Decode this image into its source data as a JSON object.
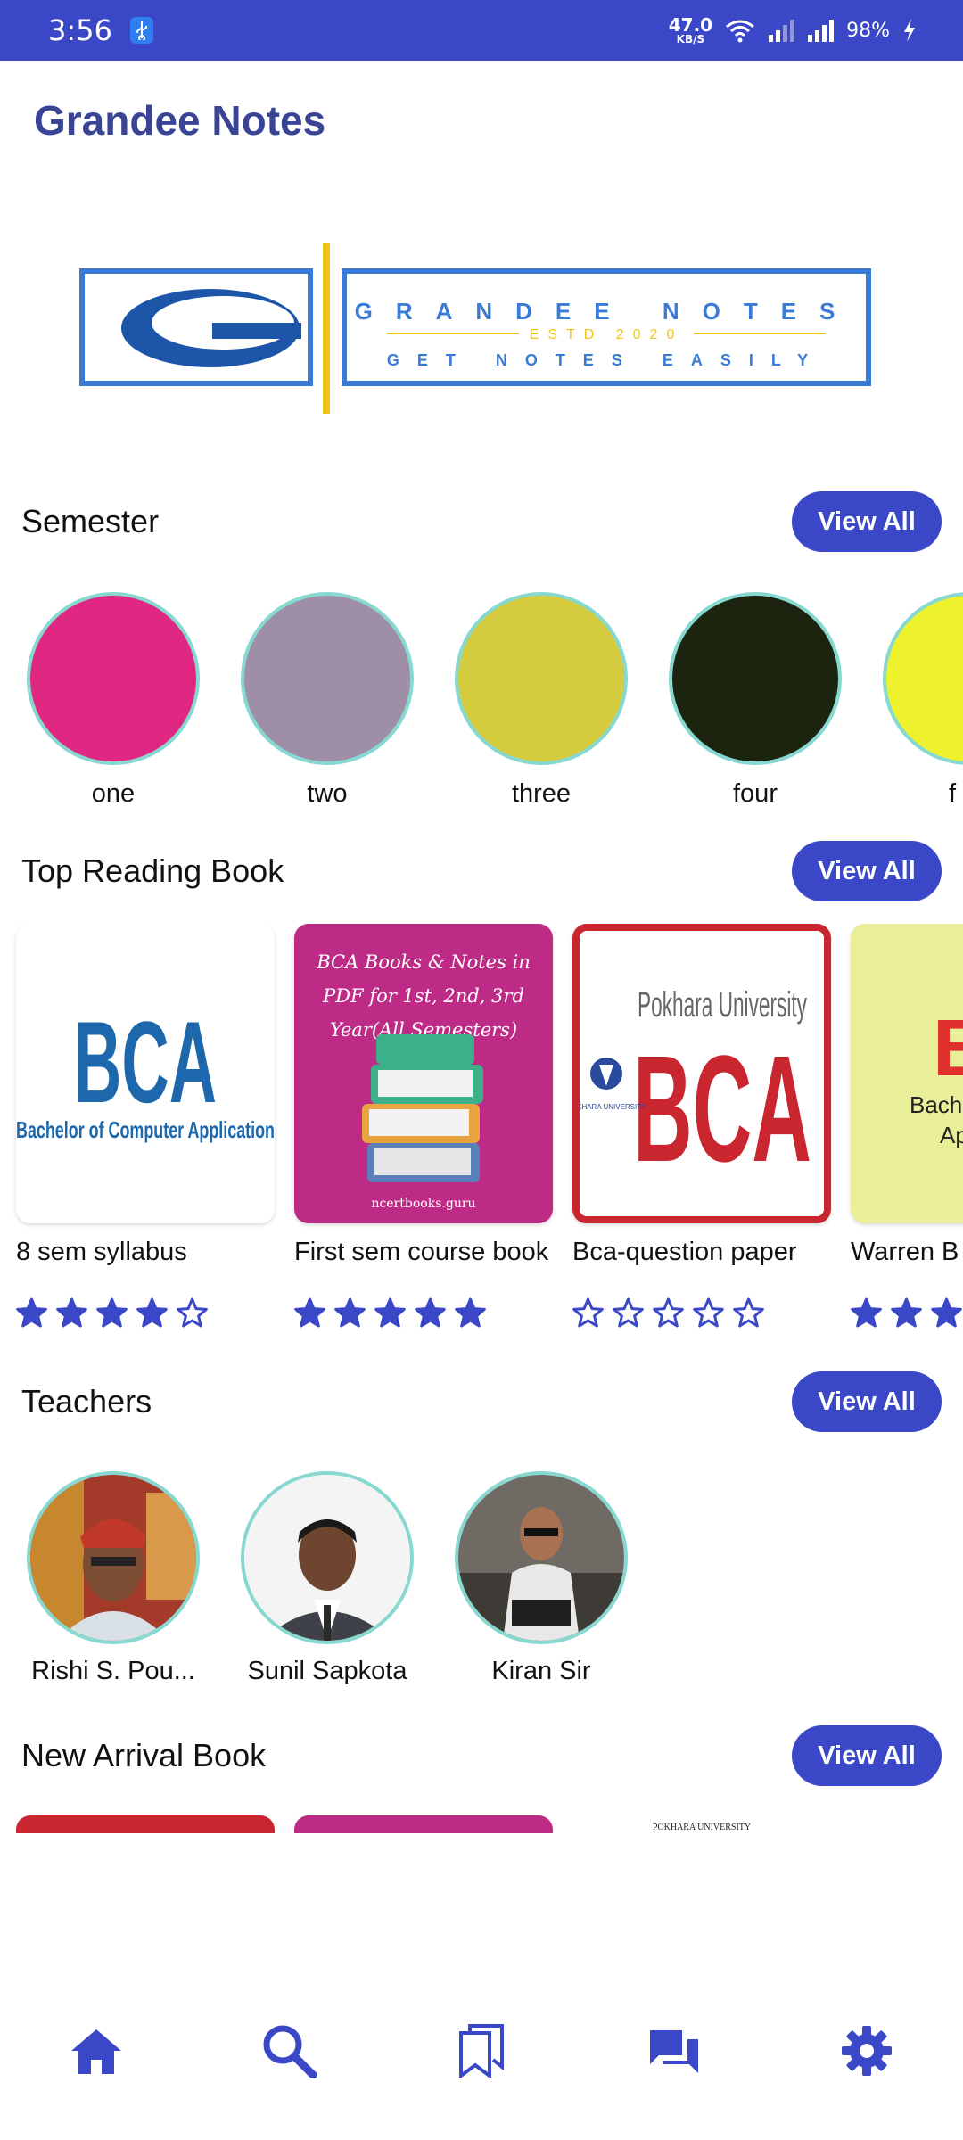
{
  "status_bar": {
    "time": "3:56",
    "usb_icon": "usb-icon",
    "net_speed": "47.0",
    "net_unit": "KB/S",
    "battery": "98%"
  },
  "app": {
    "title": "Grandee Notes"
  },
  "banner": {
    "brand": "GRANDEE NOTES",
    "est": "ESTD 2020",
    "tagline": "GET NOTES EASILY"
  },
  "semester": {
    "title": "Semester",
    "view_all": "View All",
    "items": [
      {
        "label": "one",
        "color": "#e02882"
      },
      {
        "label": "two",
        "color": "#9e8fa6"
      },
      {
        "label": "three",
        "color": "#d4cc3e"
      },
      {
        "label": "four",
        "color": "#1c2410"
      },
      {
        "label": "f",
        "color": "#eef22c"
      }
    ]
  },
  "top_reading": {
    "title": "Top Reading Book",
    "view_all": "View All",
    "books": [
      {
        "title": "8 sem syllabus",
        "rating": 4,
        "cover_big": "BCA",
        "cover_sub": "Bachelor of Computer Application"
      },
      {
        "title": "First sem course book",
        "rating": 5,
        "cover_top": "BCA Books & Notes in PDF for 1st, 2nd, 3rd Year(All Semesters)",
        "cover_footer": "ncertbooks.guru"
      },
      {
        "title": "Bca-question paper",
        "rating": 0,
        "cover_top": "Pokhara University",
        "cover_big": "BCA",
        "cover_seal": "POKHARA UNIVERSITY"
      },
      {
        "title": "Warren B",
        "rating": 3,
        "cover_big": "B",
        "cover_sub": "Bachel",
        "cover_sub2": "Ap"
      }
    ]
  },
  "teachers": {
    "title": "Teachers",
    "view_all": "View All",
    "items": [
      {
        "name": "Rishi S. Pou..."
      },
      {
        "name": "Sunil Sapkota"
      },
      {
        "name": "Kiran Sir"
      }
    ]
  },
  "new_arrival": {
    "title": "New Arrival Book",
    "view_all": "View All",
    "peek_text": "POKHARA UNIVERSITY"
  },
  "bottom_nav": [
    {
      "icon": "home-icon"
    },
    {
      "icon": "search-icon"
    },
    {
      "icon": "bookmark-icon"
    },
    {
      "icon": "chat-icon"
    },
    {
      "icon": "settings-icon"
    }
  ],
  "colors": {
    "accent": "#3a48c8",
    "title": "#3a4495",
    "ring": "#86d8d0"
  }
}
